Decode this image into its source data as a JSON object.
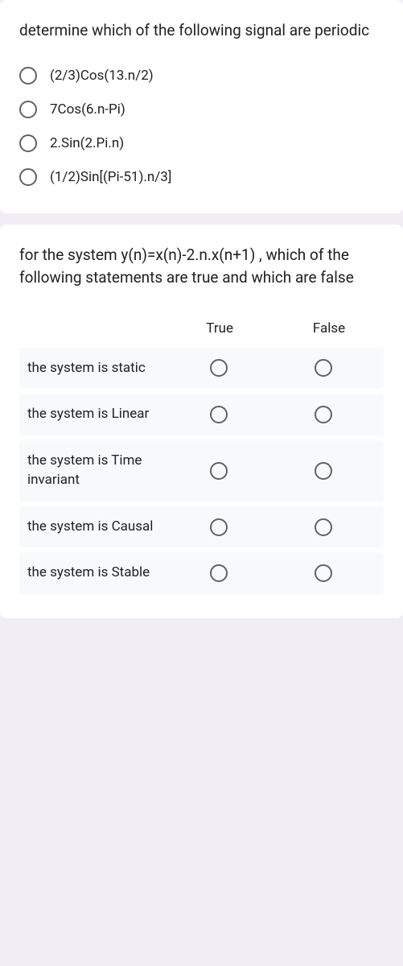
{
  "question1": {
    "prompt": "determine which of the following signal are periodic",
    "options": [
      "(2/3)Cos(13.n/2)",
      "7Cos(6.n-Pi)",
      "2.Sin(2.Pi.n)",
      "(1/2)Sin[(Pi-51).n/3]"
    ]
  },
  "question2": {
    "prompt": "for the system y(n)=x(n)-2.n.x(n+1) , which of the following statements are true and which are false",
    "columns": [
      "True",
      "False"
    ],
    "rows": [
      "the system is static",
      "the system is Linear",
      "the system is Time invariant",
      "the system is Causal",
      "the system is Stable"
    ]
  }
}
